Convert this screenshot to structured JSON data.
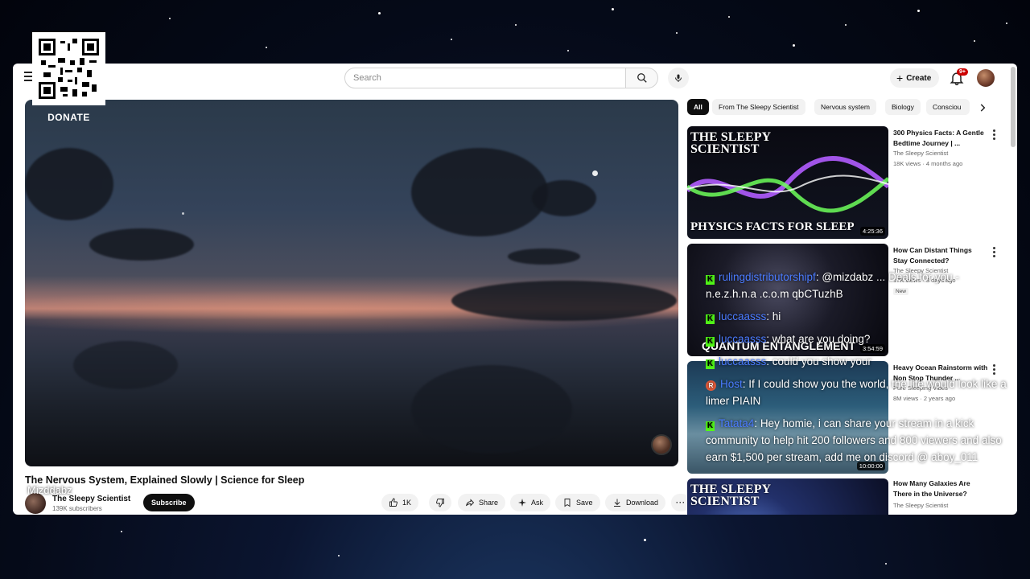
{
  "overlay": {
    "donate_label": "DONATE",
    "streamer_tag": "Mizddabz"
  },
  "masthead": {
    "search_placeholder": "Search",
    "create_label": "Create",
    "notification_count": "9+"
  },
  "video": {
    "title": "The Nervous System, Explained Slowly | Science for Sleep",
    "channel_name": "The Sleepy Scientist",
    "subscribers": "139K subscribers",
    "subscribe_label": "Subscribe",
    "actions": {
      "likes": "1K",
      "share": "Share",
      "ask": "Ask",
      "save": "Save",
      "download": "Download"
    }
  },
  "chips": [
    "All",
    "From The Sleepy Scientist",
    "Nervous system",
    "Biology",
    "Consciou"
  ],
  "recommendations": [
    {
      "thumb_line1": "THE SLEEPY",
      "thumb_line2": "SCIENTIST",
      "thumb_caption": "PHYSICS FACTS FOR SLEEP",
      "duration": "4:25:36",
      "title": "300 Physics Facts: A Gentle Bedtime Journey | ...",
      "channel": "The Sleepy Scientist",
      "meta": "18K views · 4 months ago"
    },
    {
      "thumb_caption": "QUANTUM ENTANGLEMENT",
      "duration": "3:54:59",
      "title": "How Can Distant Things Stay Connected?",
      "channel": "The Sleepy Scientist",
      "meta": "17K views · 3 days ago",
      "badge": "New"
    },
    {
      "duration": "10:00:00",
      "title": "Heavy Ocean Rainstorm with Non Stop Thunder ...",
      "channel": "Pure Sleeping Vibes",
      "meta": "8M views · 2 years ago"
    },
    {
      "thumb_line1": "THE SLEEPY",
      "thumb_line2": "SCIENTIST",
      "title": "How Many Galaxies Are There in the Universe?",
      "channel": "The Sleepy Scientist"
    }
  ],
  "chat": [
    {
      "user": "rulingdistributorshipf",
      "badge": "kick",
      "text": "@mizdabz ... Deals for you - n.e.z.h.n.a .c.o.m qbCTuzhB"
    },
    {
      "user": "luccaasss",
      "badge": "kick",
      "text": "hi"
    },
    {
      "user": "luccaasss",
      "badge": "kick",
      "text": "what are you doing?"
    },
    {
      "user": "luccaasss",
      "badge": "kick",
      "text": "could you show your"
    },
    {
      "user": "Host",
      "badge": "host",
      "text": "If I could show you the world, the life would look like a limer PIAIN"
    },
    {
      "user": "Tatata4",
      "badge": "kick",
      "text": "Hey homie, i can share your stream in a kick community to help hit 200 followers and 800 viewers and also earn $1,500 per stream, add me on discord @ aboy_011"
    }
  ]
}
